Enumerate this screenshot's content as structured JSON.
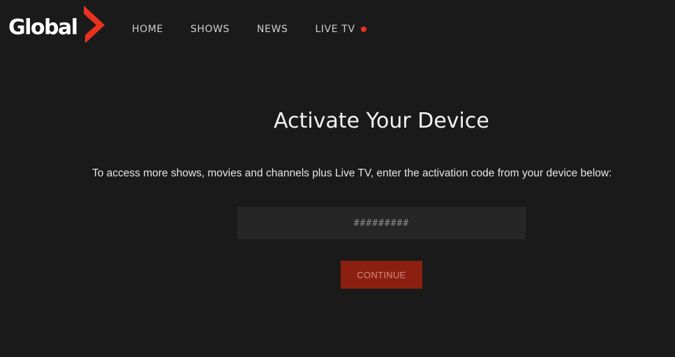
{
  "brand": {
    "name": "Global",
    "accent_color": "#e8321f",
    "logo_icon": "chevron-right-icon"
  },
  "nav": {
    "items": [
      {
        "label": "HOME"
      },
      {
        "label": "SHOWS"
      },
      {
        "label": "NEWS"
      },
      {
        "label": "LIVE TV",
        "indicator": "live-dot-icon"
      }
    ]
  },
  "main": {
    "title": "Activate Your Device",
    "subtitle": "To access more shows, movies and channels plus Live TV, enter the activation code from your device below:",
    "code_input": {
      "value": "",
      "placeholder": "#########"
    },
    "continue_label": "CONTINUE",
    "continue_color": "#8b2010"
  }
}
